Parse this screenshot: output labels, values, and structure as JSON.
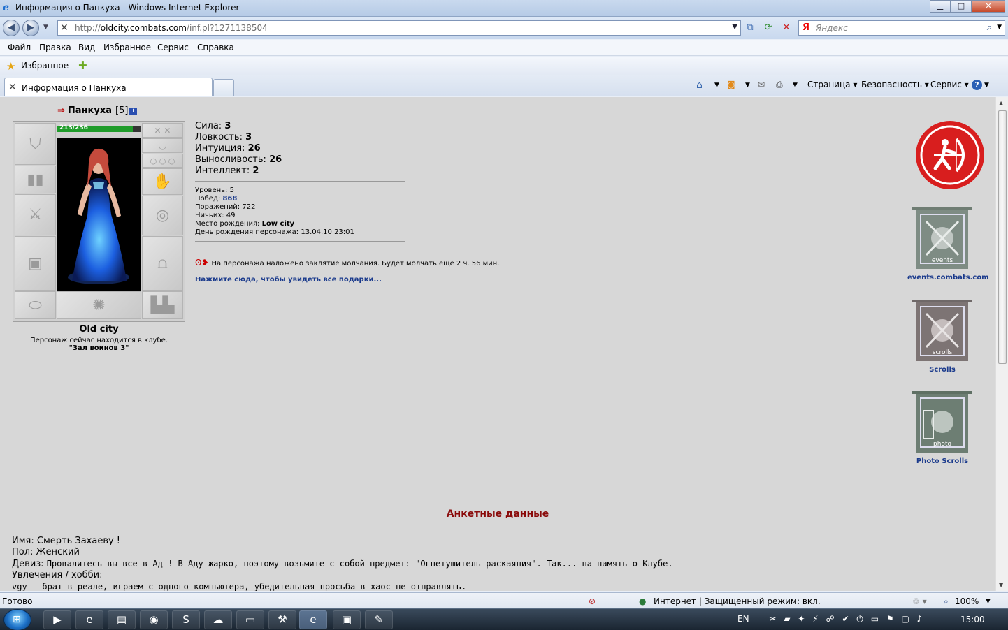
{
  "window": {
    "title": "Информация о Панкуха - Windows Internet Explorer",
    "minimize": "▁",
    "maximize": "□",
    "close": "✕"
  },
  "address": {
    "url_prefix": "http://",
    "url_host": "oldcity.combats.com",
    "url_path": "/inf.pl?1271138504",
    "search_brand": "Я",
    "search_placeholder": "Яндекс"
  },
  "menu": [
    "Файл",
    "Правка",
    "Вид",
    "Избранное",
    "Сервис",
    "Справка"
  ],
  "favorites": {
    "label": "Избранное"
  },
  "tab": {
    "title": "Информация о Панкуха"
  },
  "commandbar": {
    "page": "Страница ▾",
    "safety": "Безопасность ▾",
    "tools": "Сервис ▾"
  },
  "character": {
    "name": "Панкуха",
    "level": "[5]",
    "hp": "213/236",
    "hp_fraction": 0.9,
    "city": "Old city",
    "location_text": "Персонаж сейчас находится в клубе.",
    "location_room": "\"Зал воинов 3\""
  },
  "stats": [
    {
      "label": "Сила:",
      "value": "3"
    },
    {
      "label": "Ловкость:",
      "value": "3"
    },
    {
      "label": "Интуиция:",
      "value": "26"
    },
    {
      "label": "Выносливость:",
      "value": "26"
    },
    {
      "label": "Интеллект:",
      "value": "2"
    }
  ],
  "info": {
    "level": "Уровень: 5",
    "wins_label": "Побед:",
    "wins": "868",
    "losses": "Поражений: 722",
    "draws": "Ничьих: 49",
    "birthplace_label": "Место рождения:",
    "birthplace": "Low city",
    "birthday": "День рождения персонажа: 13.04.10 23:01"
  },
  "silence": "На персонажа наложено заклятие молчания. Будет молчать еще 2 ч. 56 мин.",
  "gifts_link": "Нажмите сюда, чтобы увидеть все подарки...",
  "right_links": {
    "events_label": "events",
    "events_caption": "events.combats.com",
    "scrolls_label": "scrolls",
    "scrolls_caption": "Scrolls",
    "photo_label": "photo",
    "photo_caption": "Photo Scrolls"
  },
  "profile": {
    "heading": "Анкетные данные",
    "name": "Имя: Смерть Захаеву !",
    "gender": "Пол: Женский",
    "motto_label": "Девиз:",
    "motto": "Провалитесь вы все в Ад ! В Аду жарко, поэтому возьмите с собой предмет: \"Огнетушитель раскаяния\". Так... на память о Клубе.",
    "hobby_label": "Увлечения / хобби:",
    "hobby": "vgy - брат в реале, играем с одного компьютера, убедительная просьба в хаос не отправлять."
  },
  "status": {
    "ready": "Готово",
    "zone": "Интернет | Защищенный режим: вкл.",
    "zoom": "100%"
  },
  "taskbar": {
    "lang": "EN",
    "time": "15:00"
  },
  "colors": {
    "logo_red": "#d81e1e",
    "link_blue": "#1a3a8c",
    "heading_red": "#8a0b0b"
  }
}
